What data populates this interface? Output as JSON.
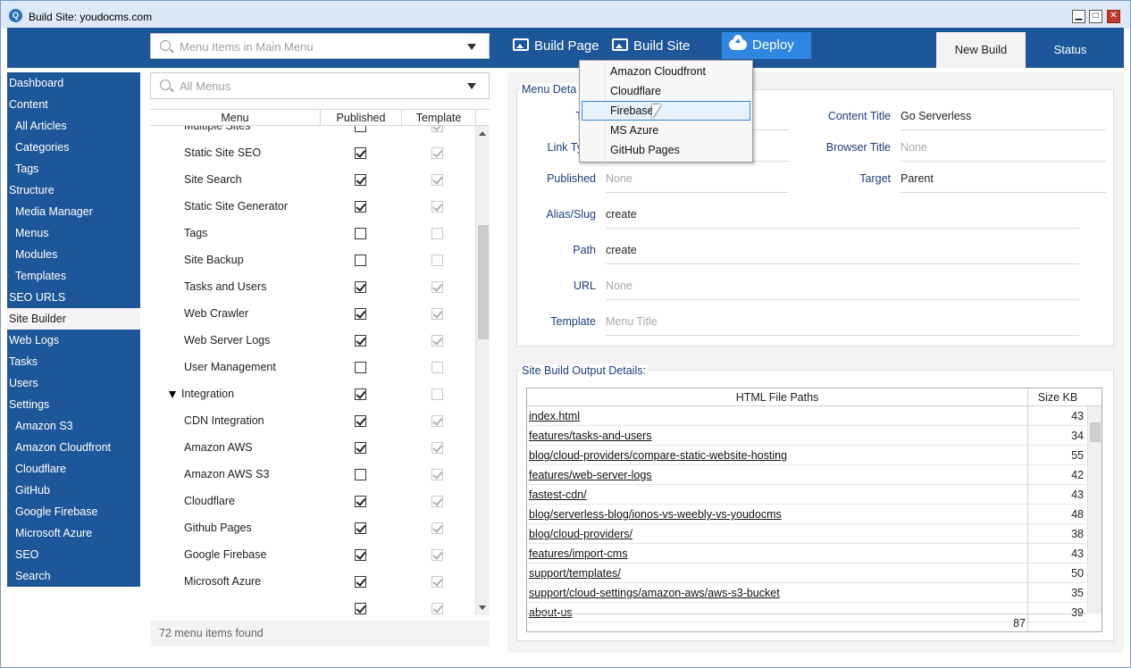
{
  "window": {
    "title": "Build Site: youdocms.com",
    "min": "▁",
    "max": "□",
    "close": "✕"
  },
  "toolbar": {
    "search_placeholder": "Menu Items in Main Menu",
    "build_page": "Build Page",
    "build_site": "Build Site",
    "deploy": "Deploy"
  },
  "tabs": {
    "new_build": "New Build",
    "status": "Status"
  },
  "sidebar": [
    {
      "label": "Dashboard",
      "sub": false
    },
    {
      "label": "Content",
      "sub": false
    },
    {
      "label": "All Articles",
      "sub": true
    },
    {
      "label": "Categories",
      "sub": true
    },
    {
      "label": "Tags",
      "sub": true
    },
    {
      "label": "Structure",
      "sub": false
    },
    {
      "label": "Media Manager",
      "sub": true
    },
    {
      "label": "Menus",
      "sub": true
    },
    {
      "label": "Modules",
      "sub": true
    },
    {
      "label": "Templates",
      "sub": true
    },
    {
      "label": "SEO URLS",
      "sub": false
    },
    {
      "label": "Site Builder",
      "sub": false,
      "active": true
    },
    {
      "label": "Web Logs",
      "sub": false
    },
    {
      "label": "Tasks",
      "sub": false
    },
    {
      "label": "Users",
      "sub": false
    },
    {
      "label": "Settings",
      "sub": false
    },
    {
      "label": "Amazon S3",
      "sub": true
    },
    {
      "label": "Amazon Cloudfront",
      "sub": true
    },
    {
      "label": "Cloudflare",
      "sub": true
    },
    {
      "label": "GitHub",
      "sub": true
    },
    {
      "label": "Google Firebase",
      "sub": true
    },
    {
      "label": "Microsoft Azure",
      "sub": true
    },
    {
      "label": "SEO",
      "sub": true
    },
    {
      "label": "Search",
      "sub": true
    }
  ],
  "menus": {
    "search_placeholder": "All Menus",
    "col_menu": "Menu",
    "col_published": "Published",
    "col_template": "Template",
    "found": "72 menu items found",
    "rows": [
      {
        "label": "Multiple Sites",
        "published": false,
        "template": true,
        "group": false
      },
      {
        "label": "Static Site SEO",
        "published": true,
        "template": true,
        "group": false
      },
      {
        "label": "Site Search",
        "published": true,
        "template": true,
        "group": false
      },
      {
        "label": "Static Site Generator",
        "published": true,
        "template": true,
        "group": false
      },
      {
        "label": "Tags",
        "published": false,
        "template": false,
        "group": false
      },
      {
        "label": "Site Backup",
        "published": false,
        "template": false,
        "group": false
      },
      {
        "label": "Tasks and Users",
        "published": true,
        "template": true,
        "group": false
      },
      {
        "label": "Web Crawler",
        "published": true,
        "template": true,
        "group": false
      },
      {
        "label": "Web Server Logs",
        "published": true,
        "template": true,
        "group": false
      },
      {
        "label": "User Management",
        "published": false,
        "template": false,
        "group": false
      },
      {
        "label": "Integration",
        "published": true,
        "template": false,
        "group": true
      },
      {
        "label": "CDN Integration",
        "published": true,
        "template": true,
        "group": false
      },
      {
        "label": "Amazon AWS",
        "published": true,
        "template": true,
        "group": false
      },
      {
        "label": "Amazon AWS S3",
        "published": false,
        "template": true,
        "group": false
      },
      {
        "label": "Cloudflare",
        "published": true,
        "template": true,
        "group": false
      },
      {
        "label": "Github Pages",
        "published": true,
        "template": true,
        "group": false
      },
      {
        "label": "Google Firebase",
        "published": true,
        "template": true,
        "group": false
      },
      {
        "label": "Microsoft Azure",
        "published": true,
        "template": true,
        "group": false
      },
      {
        "label": "",
        "published": true,
        "template": true,
        "group": false
      }
    ]
  },
  "menu_details": {
    "legend": "Menu Deta",
    "title_label": "T",
    "link_type_label": "Link Ty",
    "published_label": "Published",
    "published_value": "None",
    "alias_label": "Alias/Slug",
    "alias_value": "create",
    "path_label": "Path",
    "path_value": "create",
    "url_label": "URL",
    "url_value": "None",
    "template_label": "Template",
    "template_value": "Menu Title",
    "content_title_label": "Content Title",
    "content_title_value": "Go Serverless",
    "browser_title_label": "Browser Title",
    "browser_title_value": "None",
    "target_label": "Target",
    "target_value": "Parent"
  },
  "output": {
    "legend": "Site Build Output Details:",
    "col_paths": "HTML File Paths",
    "col_size": "Size KB",
    "rows": [
      {
        "path": "index.html",
        "size": "43"
      },
      {
        "path": "features/tasks-and-users",
        "size": "34"
      },
      {
        "path": "blog/cloud-providers/compare-static-website-hosting",
        "size": "55"
      },
      {
        "path": "features/web-server-logs",
        "size": "42"
      },
      {
        "path": "fastest-cdn/",
        "size": "43"
      },
      {
        "path": "blog/serverless-blog/ionos-vs-weebly-vs-youdocms",
        "size": "48"
      },
      {
        "path": "blog/cloud-providers/",
        "size": "38"
      },
      {
        "path": "features/import-cms",
        "size": "43"
      },
      {
        "path": "support/templates/",
        "size": "50"
      },
      {
        "path": "support/cloud-settings/amazon-aws/aws-s3-bucket",
        "size": "35"
      },
      {
        "path": "about-us",
        "size": "39"
      }
    ],
    "total": "87"
  },
  "deploy_menu": {
    "items": [
      "Amazon Cloudfront",
      "Cloudflare",
      "Firebase",
      "MS Azure",
      "GitHub Pages"
    ],
    "hovered_index": 2
  }
}
